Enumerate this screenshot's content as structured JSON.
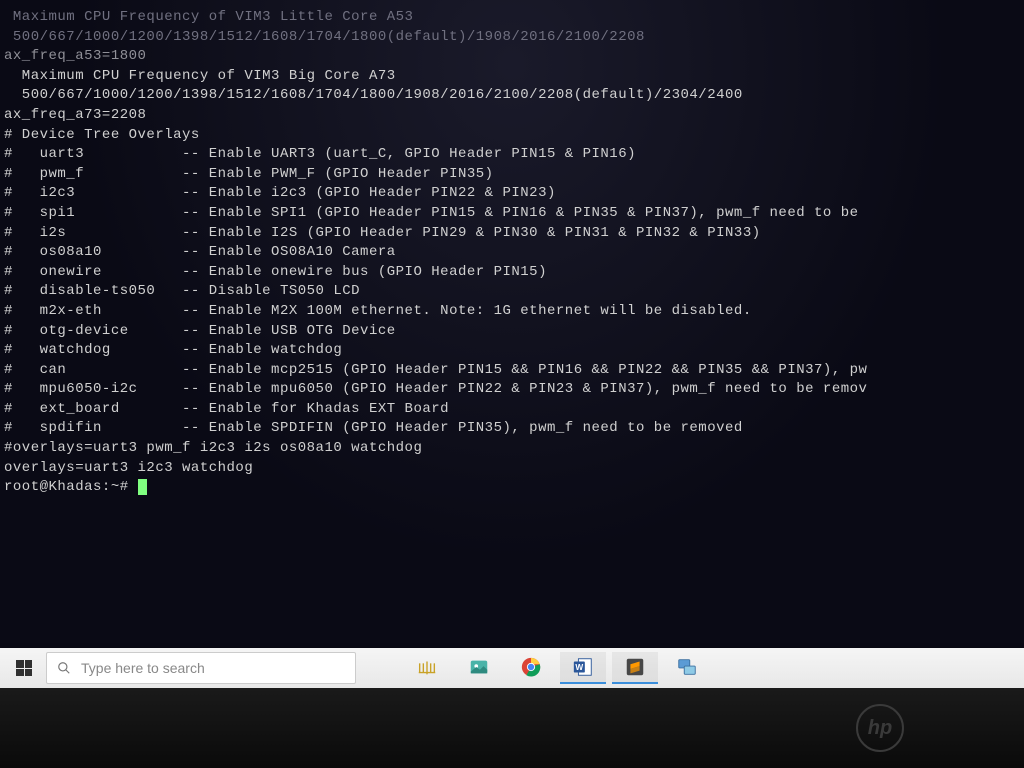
{
  "terminal": {
    "lines": [
      {
        "cls": "faded",
        "text": ""
      },
      {
        "cls": "faded",
        "text": ""
      },
      {
        "cls": "faded",
        "text": " Maximum CPU Frequency of VIM3 Little Core A53"
      },
      {
        "cls": "faded",
        "text": " 500/667/1000/1200/1398/1512/1608/1704/1800(default)/1908/2016/2100/2208"
      },
      {
        "cls": "dim",
        "text": "ax_freq_a53=1800"
      },
      {
        "cls": "",
        "text": ""
      },
      {
        "cls": "",
        "text": "  Maximum CPU Frequency of VIM3 Big Core A73"
      },
      {
        "cls": "",
        "text": "  500/667/1000/1200/1398/1512/1608/1704/1800/1908/2016/2100/2208(default)/2304/2400"
      },
      {
        "cls": "",
        "text": "ax_freq_a73=2208"
      },
      {
        "cls": "",
        "text": ""
      },
      {
        "cls": "",
        "text": "# Device Tree Overlays"
      },
      {
        "cls": "",
        "text": "#   uart3           -- Enable UART3 (uart_C, GPIO Header PIN15 & PIN16)"
      },
      {
        "cls": "",
        "text": "#   pwm_f           -- Enable PWM_F (GPIO Header PIN35)"
      },
      {
        "cls": "",
        "text": "#   i2c3            -- Enable i2c3 (GPIO Header PIN22 & PIN23)"
      },
      {
        "cls": "",
        "text": "#   spi1            -- Enable SPI1 (GPIO Header PIN15 & PIN16 & PIN35 & PIN37), pwm_f need to be"
      },
      {
        "cls": "",
        "text": "#   i2s             -- Enable I2S (GPIO Header PIN29 & PIN30 & PIN31 & PIN32 & PIN33)"
      },
      {
        "cls": "",
        "text": "#   os08a10         -- Enable OS08A10 Camera"
      },
      {
        "cls": "",
        "text": "#   onewire         -- Enable onewire bus (GPIO Header PIN15)"
      },
      {
        "cls": "",
        "text": "#   disable-ts050   -- Disable TS050 LCD"
      },
      {
        "cls": "",
        "text": "#   m2x-eth         -- Enable M2X 100M ethernet. Note: 1G ethernet will be disabled."
      },
      {
        "cls": "",
        "text": "#   otg-device      -- Enable USB OTG Device"
      },
      {
        "cls": "",
        "text": "#   watchdog        -- Enable watchdog"
      },
      {
        "cls": "",
        "text": "#   can             -- Enable mcp2515 (GPIO Header PIN15 && PIN16 && PIN22 && PIN35 && PIN37), pw"
      },
      {
        "cls": "",
        "text": "#   mpu6050-i2c     -- Enable mpu6050 (GPIO Header PIN22 & PIN23 & PIN37), pwm_f need to be remov"
      },
      {
        "cls": "",
        "text": "#   ext_board       -- Enable for Khadas EXT Board"
      },
      {
        "cls": "",
        "text": "#   spdifin         -- Enable SPDIFIN (GPIO Header PIN35), pwm_f need to be removed"
      },
      {
        "cls": "",
        "text": "#overlays=uart3 pwm_f i2c3 i2s os08a10 watchdog"
      },
      {
        "cls": "",
        "text": "overlays=uart3 i2c3 watchdog"
      }
    ],
    "prompt": "root@Khadas:~# "
  },
  "taskbar": {
    "search_placeholder": "Type here to search"
  },
  "bezel": {
    "logo": "hp"
  }
}
